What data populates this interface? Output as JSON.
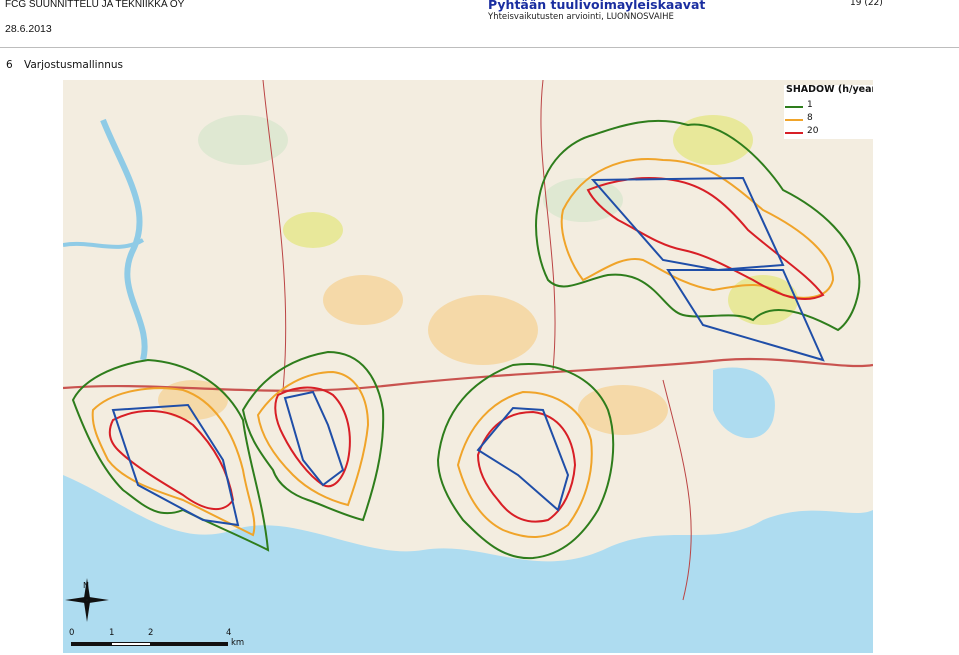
{
  "header": {
    "company": "FCG SUUNNITTELU JA TEKNIIKKA OY",
    "date": "28.6.2013",
    "title": "Pyhtään tuulivoimayleiskaavat",
    "subtitle": "Yhteisvaikutusten arviointi, LUONNOSVAIHE",
    "page": "19 (22)"
  },
  "section": {
    "number": "6",
    "title": "Varjostusmallinnus"
  },
  "legend": {
    "title": "SHADOW (h/year)",
    "items": [
      {
        "label": "1",
        "color": "#2e7d1c"
      },
      {
        "label": "8",
        "color": "#f0a42a"
      },
      {
        "label": "20",
        "color": "#d81f26"
      }
    ]
  },
  "boundary_color": "#1f4ea8",
  "scale_bar": {
    "labels": [
      "0",
      "1",
      "2",
      "4"
    ],
    "unit": "km"
  },
  "north_arrow": {
    "label": "N"
  }
}
